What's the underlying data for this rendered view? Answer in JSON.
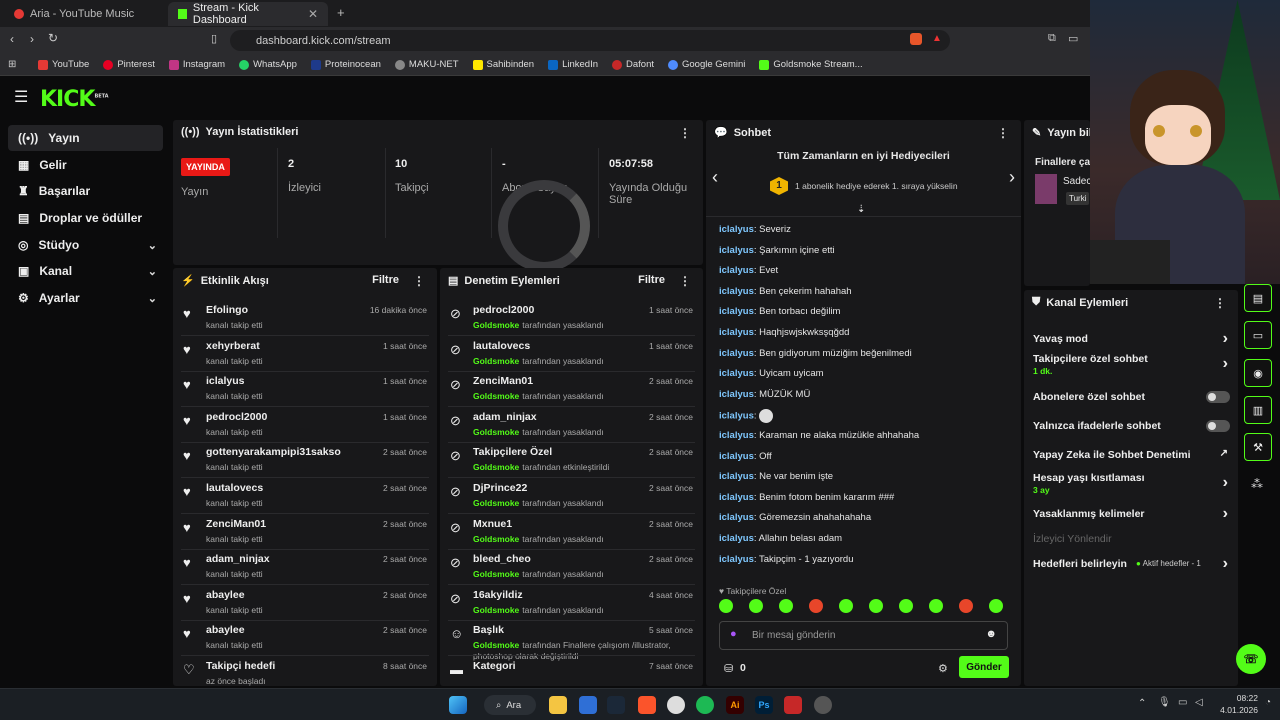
{
  "browser": {
    "tabs": [
      {
        "title": "Aria - YouTube Music",
        "active": false
      },
      {
        "title": "Stream - Kick Dashboard",
        "active": true
      }
    ],
    "url": "dashboard.kick.com/stream",
    "bookmarks": [
      "YouTube",
      "Pinterest",
      "Instagram",
      "WhatsApp",
      "Proteinocean",
      "MAKU-NET",
      "Sahibinden",
      "LinkedIn",
      "Dafont",
      "Google Gemini",
      "Goldsmoke Stream..."
    ]
  },
  "app": {
    "logo": "KICK",
    "logo_badge": "BETA"
  },
  "sidebar": {
    "items": [
      {
        "label": "Yayın",
        "icon": "broadcast-icon"
      },
      {
        "label": "Gelir",
        "icon": "revenue-icon"
      },
      {
        "label": "Başarılar",
        "icon": "trophy-icon"
      },
      {
        "label": "Droplar ve ödüller",
        "icon": "gift-icon"
      },
      {
        "label": "Stüdyo",
        "icon": "studio-icon"
      },
      {
        "label": "Kanal",
        "icon": "channel-icon"
      },
      {
        "label": "Ayarlar",
        "icon": "gear-icon"
      }
    ]
  },
  "stats": {
    "title": "Yayın İstatistikleri",
    "live_badge": "YAYINDA",
    "items": [
      {
        "value": "",
        "label": "Yayın"
      },
      {
        "value": "2",
        "label": "İzleyici"
      },
      {
        "value": "10",
        "label": "Takipçi"
      },
      {
        "value": "-",
        "label": "Abone Sayısı"
      },
      {
        "value": "05:07:58",
        "label": "Yayında Olduğu Süre"
      }
    ]
  },
  "activity": {
    "title": "Etkinlik Akışı",
    "filter": "Filtre",
    "items": [
      {
        "name": "Efolingo",
        "sub": "kanalı takip etti",
        "time": "16 dakika önce"
      },
      {
        "name": "xehyrberat",
        "sub": "kanalı takip etti",
        "time": "1 saat önce"
      },
      {
        "name": "iclalyus",
        "sub": "kanalı takip etti",
        "time": "1 saat önce"
      },
      {
        "name": "pedrocl2000",
        "sub": "kanalı takip etti",
        "time": "1 saat önce"
      },
      {
        "name": "gottenyarakampipi31sakso",
        "sub": "kanalı takip etti",
        "time": "2 saat önce"
      },
      {
        "name": "lautalovecs",
        "sub": "kanalı takip etti",
        "time": "2 saat önce"
      },
      {
        "name": "ZenciMan01",
        "sub": "kanalı takip etti",
        "time": "2 saat önce"
      },
      {
        "name": "adam_ninjax",
        "sub": "kanalı takip etti",
        "time": "2 saat önce"
      },
      {
        "name": "abaylee",
        "sub": "kanalı takip etti",
        "time": "2 saat önce"
      },
      {
        "name": "abaylee",
        "sub": "kanalı takip etti",
        "time": "2 saat önce"
      },
      {
        "name": "Takipçi hedefi",
        "sub": "az önce başladı",
        "time": "8 saat önce"
      }
    ]
  },
  "moderation": {
    "title": "Denetim Eylemleri",
    "filter": "Filtre",
    "items": [
      {
        "name": "pedrocl2000",
        "actor": "Goldsmoke",
        "sub": "tarafından yasaklandı",
        "time": "1 saat önce"
      },
      {
        "name": "lautalovecs",
        "actor": "Goldsmoke",
        "sub": "tarafından yasaklandı",
        "time": "1 saat önce"
      },
      {
        "name": "ZenciMan01",
        "actor": "Goldsmoke",
        "sub": "tarafından yasaklandı",
        "time": "2 saat önce"
      },
      {
        "name": "adam_ninjax",
        "actor": "Goldsmoke",
        "sub": "tarafından yasaklandı",
        "time": "2 saat önce"
      },
      {
        "name": "Takipçilere Özel",
        "actor": "Goldsmoke",
        "sub": "tarafından etkinleştirildi",
        "time": "2 saat önce"
      },
      {
        "name": "DjPrince22",
        "actor": "Goldsmoke",
        "sub": "tarafından yasaklandı",
        "time": "2 saat önce"
      },
      {
        "name": "Mxnue1",
        "actor": "Goldsmoke",
        "sub": "tarafından yasaklandı",
        "time": "2 saat önce"
      },
      {
        "name": "bleed_cheo",
        "actor": "Goldsmoke",
        "sub": "tarafından yasaklandı",
        "time": "2 saat önce"
      },
      {
        "name": "16akyildiz",
        "actor": "Goldsmoke",
        "sub": "tarafından yasaklandı",
        "time": "4 saat önce"
      },
      {
        "name": "Başlık",
        "actor": "Goldsmoke",
        "sub": "tarafından Finallere çalışıom /illustrator, photoshop olarak değiştirildi",
        "time": "5 saat önce"
      },
      {
        "name": "Kategori",
        "actor": "",
        "sub": "",
        "time": "7 saat önce"
      }
    ]
  },
  "chat": {
    "title": "Sohbet",
    "top_gifters": "Tüm Zamanların en iyi Hediyecileri",
    "gift_rank": "1",
    "gift_text": "1 abonelik hediye ederek 1. sıraya yükselin",
    "messages": [
      {
        "user": "iclalyus",
        "text": "Severiz"
      },
      {
        "user": "iclalyus",
        "text": "Şarkımın içine etti"
      },
      {
        "user": "iclalyus",
        "text": "Evet"
      },
      {
        "user": "iclalyus",
        "text": "Ben çekerim hahahah"
      },
      {
        "user": "iclalyus",
        "text": "Ben torbacı değilim"
      },
      {
        "user": "iclalyus",
        "text": "Haqhjswjskwksşqğdd"
      },
      {
        "user": "iclalyus",
        "text": "Ben gidiyorum müziğim beğenilmedi"
      },
      {
        "user": "iclalyus",
        "text": "Uyicam uyicam"
      },
      {
        "user": "iclalyus",
        "text": "MÜZÜK MÜ"
      },
      {
        "user": "iclalyus",
        "text": ""
      },
      {
        "user": "iclalyus",
        "text": "Karaman ne alaka müzükle ahhahaha"
      },
      {
        "user": "iclalyus",
        "text": "Off"
      },
      {
        "user": "iclalyus",
        "text": "Ne var benim işte"
      },
      {
        "user": "iclalyus",
        "text": "Benim fotom benim kararım ###"
      },
      {
        "user": "iclalyus",
        "text": "Göremezsin ahahahahaha"
      },
      {
        "user": "iclalyus",
        "text": "Allahın belası adam"
      },
      {
        "user": "iclalyus",
        "text": "Takipçim - 1 yazıyordu"
      }
    ],
    "followers_only": "Takipçilere Özel",
    "input_placeholder": "Bir mesaj gönderin",
    "points": "0",
    "send": "Gönder"
  },
  "stream_info": {
    "title": "Yayın bilgi",
    "line1": "Finallere çal",
    "line2": "Sadec",
    "tag": "Turki"
  },
  "channel_actions": {
    "title": "Kanal Eylemleri",
    "items": [
      {
        "label": "Yavaş mod",
        "sub": "",
        "control": "chevron"
      },
      {
        "label": "Takipçilere özel sohbet",
        "sub": "1 dk.",
        "control": "chevron"
      },
      {
        "label": "Abonelere özel sohbet",
        "sub": "",
        "control": "toggle"
      },
      {
        "label": "Yalnızca ifadelerle sohbet",
        "sub": "",
        "control": "toggle"
      },
      {
        "label": "Yapay Zeka ile Sohbet Denetimi",
        "sub": "",
        "control": "external"
      },
      {
        "label": "Hesap yaşı kısıtlaması",
        "sub": "3 ay",
        "control": "chevron"
      },
      {
        "label": "Yasaklanmış kelimeler",
        "sub": "",
        "control": "chevron"
      },
      {
        "label": "İzleyici Yönlendir",
        "sub": "",
        "control": "none"
      },
      {
        "label": "Hedefleri belirleyin",
        "sub": "",
        "control": "chevron",
        "status": "Aktif hedefler - 1"
      }
    ]
  },
  "taskbar": {
    "search": "Ara",
    "time": "08:22",
    "date": "4.01.2026"
  },
  "colors": {
    "accent": "#53fc18",
    "live": "#e91916",
    "bg": "#0b0b0c",
    "panel": "#18181a"
  }
}
